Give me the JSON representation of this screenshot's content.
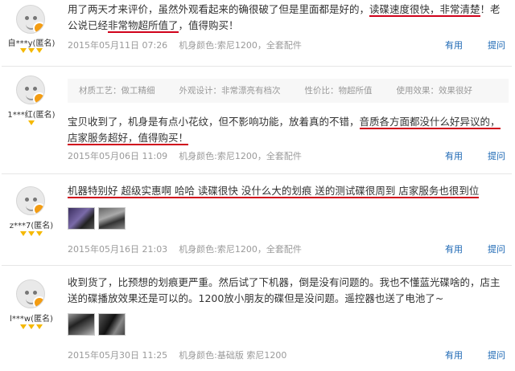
{
  "reviews": [
    {
      "user": "自***y(匿名)",
      "text_parts": [
        "用了两天才来评价，虽然外观看起来的确很破了但是里面都是好的，",
        "读碟速度很快，非常清楚",
        "！老公说已经",
        "非常物超所值了",
        "，值得购买！"
      ],
      "date": "2015年05月11日 07:26",
      "color": "机身颜色:索尼1200，全套配件",
      "useful": "有用",
      "ask": "提问"
    },
    {
      "user": "1***红(匿名)",
      "tags": [
        "材质工艺：做工精细",
        "外观设计：非常漂亮有档次",
        "性价比：物超所值",
        "使用效果：效果很好"
      ],
      "text_parts": [
        "宝贝收到了，机身是有点小花纹，但不影响功能，放着真的不错，",
        "音质各方面都没什么好异议的，店家服务超好，值得购买！"
      ],
      "date": "2015年05月06日 11:09",
      "color": "机身颜色:索尼1200，全套配件",
      "useful": "有用",
      "ask": "提问"
    },
    {
      "user": "z***7(匿名)",
      "text_parts": [
        "机器特别好 超级实惠啊 哈哈 读碟很快 没什么大的划痕 送的测试碟很周到 店家服务也很到位"
      ],
      "date": "2015年05月16日 21:03",
      "color": "机身颜色:索尼1200，全套配件",
      "useful": "有用",
      "ask": "提问"
    },
    {
      "user": "l***w(匿名)",
      "text_parts": [
        "收到货了，比预想的划痕更严重。然后试了下机器，倒是没有问题的。我也不懂蓝光碟啥的，店主送的碟播放效果还是可以的。1200放小朋友的碟但是没问题。遥控器也送了电池了~"
      ],
      "date": "2015年05月30日 11:25",
      "color": "机身颜色:基础版 索尼1200",
      "useful": "有用",
      "ask": "提问"
    }
  ]
}
